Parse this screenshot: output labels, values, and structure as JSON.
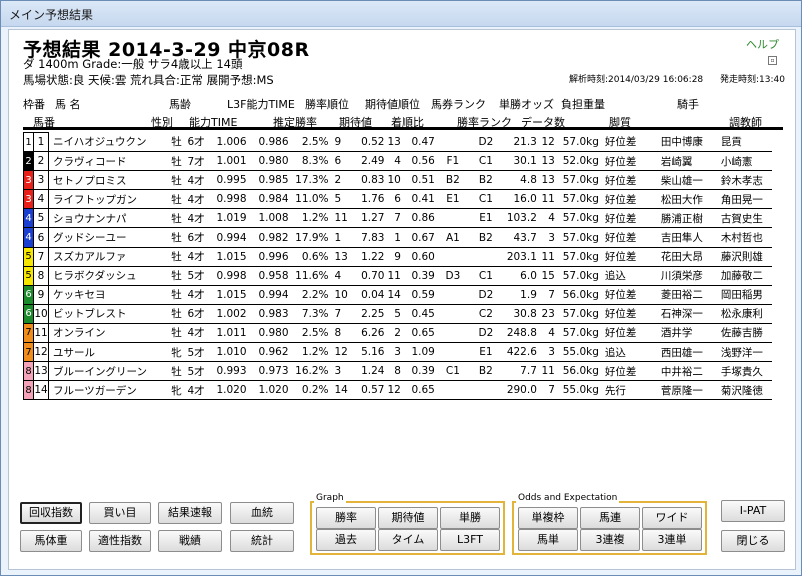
{
  "window": {
    "title": "メイン予想結果"
  },
  "race": {
    "title": "予想結果 2014-3-29 中京08R",
    "help": "ヘルプ",
    "condition1": "ダ 1400m  Grade:一般 サラ4歳以上  14頭",
    "condition2": "馬場状態:良   天候:雲   荒れ具合:正常   展開予想:MS",
    "analysis_time": "解析時刻:2014/03/29 16:06:28",
    "start_time": "発走時刻:13:40"
  },
  "header_top": {
    "waku": "枠番",
    "uma": "馬  名",
    "age": "馬齢",
    "l3f": "L3F能力TIME",
    "win_rank": "勝率順位",
    "exp_rank": "期待値順位",
    "ticket_rank": "馬券ランク",
    "odds": "単勝オッズ",
    "weight": "負担重量",
    "jockey": "騎手"
  },
  "header_bottom": {
    "umaban": "馬番",
    "sex": "性別",
    "ability": "能力TIME",
    "est_win": "推定勝率",
    "exp_val": "期待値",
    "order_ratio": "着順比",
    "win_rank": "勝率ランク",
    "data_count": "データ数",
    "style": "脚質",
    "trainer": "調教師"
  },
  "colors": {
    "frame1": "#ffffff",
    "frame2": "#000000",
    "frame3": "#e8201a",
    "frame4": "#1a3fd0",
    "frame5": "#f5e600",
    "frame6": "#1a8a2a",
    "frame7": "#f08c1a",
    "frame8": "#f5a3b8",
    "group_border": "#e2b43a",
    "help": "#2f8a2f"
  },
  "rows": [
    {
      "waku": "1",
      "num": "1",
      "name": "ニイハオジュウクン",
      "sex": "牡",
      "age": "6才",
      "ability": "1.006",
      "l3f": "0.986",
      "est": "2.5%",
      "wrank": "9",
      "exp": "0.52",
      "erank": "13",
      "order": "0.47",
      "ticket": "",
      "rank": "D2",
      "odds": "21.3",
      "data": "12",
      "weight": "57.0kg",
      "style": "好位差",
      "jockey": "田中博康",
      "trainer": "昆貢"
    },
    {
      "waku": "2",
      "num": "2",
      "name": "クラヴィコード",
      "sex": "牡",
      "age": "7才",
      "ability": "1.001",
      "l3f": "0.980",
      "est": "8.3%",
      "wrank": "6",
      "exp": "2.49",
      "erank": "4",
      "order": "0.56",
      "ticket": "F1",
      "rank": "C1",
      "odds": "30.1",
      "data": "13",
      "weight": "52.0kg",
      "style": "好位差",
      "jockey": "岩崎翼",
      "trainer": "小崎憲"
    },
    {
      "waku": "3",
      "num": "3",
      "name": "セトノプロミス",
      "sex": "牡",
      "age": "4才",
      "ability": "0.995",
      "l3f": "0.985",
      "est": "17.3%",
      "wrank": "2",
      "exp": "0.83",
      "erank": "10",
      "order": "0.51",
      "ticket": "B2",
      "rank": "B2",
      "odds": "4.8",
      "data": "13",
      "weight": "57.0kg",
      "style": "好位差",
      "jockey": "柴山雄一",
      "trainer": "鈴木孝志"
    },
    {
      "waku": "3",
      "num": "4",
      "name": "ライフトップガン",
      "sex": "牡",
      "age": "4才",
      "ability": "0.998",
      "l3f": "0.984",
      "est": "11.0%",
      "wrank": "5",
      "exp": "1.76",
      "erank": "6",
      "order": "0.41",
      "ticket": "E1",
      "rank": "C1",
      "odds": "16.0",
      "data": "11",
      "weight": "57.0kg",
      "style": "好位差",
      "jockey": "松田大作",
      "trainer": "角田晃一"
    },
    {
      "waku": "4",
      "num": "5",
      "name": "ショウナンナパ",
      "sex": "牡",
      "age": "4才",
      "ability": "1.019",
      "l3f": "1.008",
      "est": "1.2%",
      "wrank": "11",
      "exp": "1.27",
      "erank": "7",
      "order": "0.86",
      "ticket": "",
      "rank": "E1",
      "odds": "103.2",
      "data": "4",
      "weight": "57.0kg",
      "style": "好位差",
      "jockey": "勝浦正樹",
      "trainer": "古賀史生"
    },
    {
      "waku": "4",
      "num": "6",
      "name": "グッドシーユー",
      "sex": "牡",
      "age": "6才",
      "ability": "0.994",
      "l3f": "0.982",
      "est": "17.9%",
      "wrank": "1",
      "exp": "7.83",
      "erank": "1",
      "order": "0.67",
      "ticket": "A1",
      "rank": "B2",
      "odds": "43.7",
      "data": "3",
      "weight": "57.0kg",
      "style": "好位差",
      "jockey": "吉田隼人",
      "trainer": "木村哲也"
    },
    {
      "waku": "5",
      "num": "7",
      "name": "スズカアルファ",
      "sex": "牡",
      "age": "4才",
      "ability": "1.015",
      "l3f": "0.996",
      "est": "0.6%",
      "wrank": "13",
      "exp": "1.22",
      "erank": "9",
      "order": "0.60",
      "ticket": "",
      "rank": "",
      "odds": "203.1",
      "data": "11",
      "weight": "57.0kg",
      "style": "好位差",
      "jockey": "花田大昂",
      "trainer": "藤沢則雄"
    },
    {
      "waku": "5",
      "num": "8",
      "name": "ヒラボクダッシュ",
      "sex": "牡",
      "age": "5才",
      "ability": "0.998",
      "l3f": "0.958",
      "est": "11.6%",
      "wrank": "4",
      "exp": "0.70",
      "erank": "11",
      "order": "0.39",
      "ticket": "D3",
      "rank": "C1",
      "odds": "6.0",
      "data": "15",
      "weight": "57.0kg",
      "style": "追込",
      "jockey": "川須栄彦",
      "trainer": "加藤敬二"
    },
    {
      "waku": "6",
      "num": "9",
      "name": "ケッキセヨ",
      "sex": "牡",
      "age": "4才",
      "ability": "1.015",
      "l3f": "0.994",
      "est": "2.2%",
      "wrank": "10",
      "exp": "0.04",
      "erank": "14",
      "order": "0.59",
      "ticket": "",
      "rank": "D2",
      "odds": "1.9",
      "data": "7",
      "weight": "56.0kg",
      "style": "好位差",
      "jockey": "菱田裕二",
      "trainer": "岡田稲男"
    },
    {
      "waku": "6",
      "num": "10",
      "name": "ビットブレスト",
      "sex": "牡",
      "age": "6才",
      "ability": "1.002",
      "l3f": "0.983",
      "est": "7.3%",
      "wrank": "7",
      "exp": "2.25",
      "erank": "5",
      "order": "0.45",
      "ticket": "",
      "rank": "C2",
      "odds": "30.8",
      "data": "23",
      "weight": "57.0kg",
      "style": "好位差",
      "jockey": "石神深一",
      "trainer": "松永康利"
    },
    {
      "waku": "7",
      "num": "11",
      "name": "オンライン",
      "sex": "牡",
      "age": "4才",
      "ability": "1.011",
      "l3f": "0.980",
      "est": "2.5%",
      "wrank": "8",
      "exp": "6.26",
      "erank": "2",
      "order": "0.65",
      "ticket": "",
      "rank": "D2",
      "odds": "248.8",
      "data": "4",
      "weight": "57.0kg",
      "style": "好位差",
      "jockey": "酒井学",
      "trainer": "佐藤吉勝"
    },
    {
      "waku": "7",
      "num": "12",
      "name": "ユサール",
      "sex": "牝",
      "age": "5才",
      "ability": "1.010",
      "l3f": "0.962",
      "est": "1.2%",
      "wrank": "12",
      "exp": "5.16",
      "erank": "3",
      "order": "1.09",
      "ticket": "",
      "rank": "E1",
      "odds": "422.6",
      "data": "3",
      "weight": "55.0kg",
      "style": "追込",
      "jockey": "西田雄一",
      "trainer": "浅野洋一"
    },
    {
      "waku": "8",
      "num": "13",
      "name": "ブルーイングリーン",
      "sex": "牡",
      "age": "5才",
      "ability": "0.993",
      "l3f": "0.973",
      "est": "16.2%",
      "wrank": "3",
      "exp": "1.24",
      "erank": "8",
      "order": "0.39",
      "ticket": "C1",
      "rank": "B2",
      "odds": "7.7",
      "data": "11",
      "weight": "56.0kg",
      "style": "好位差",
      "jockey": "中井裕二",
      "trainer": "手塚貴久"
    },
    {
      "waku": "8",
      "num": "14",
      "name": "フルーツガーデン",
      "sex": "牝",
      "age": "4才",
      "ability": "1.020",
      "l3f": "1.020",
      "est": "0.2%",
      "wrank": "14",
      "exp": "0.57",
      "erank": "12",
      "order": "0.65",
      "ticket": "",
      "rank": "",
      "odds": "290.0",
      "data": "7",
      "weight": "55.0kg",
      "style": "先行",
      "jockey": "菅原隆一",
      "trainer": "菊沢隆徳"
    }
  ],
  "buttons": {
    "recovery": "回収指数",
    "buy": "買い目",
    "result": "結果速報",
    "blood": "血統",
    "weight": "馬体重",
    "aptitude": "適性指数",
    "record": "戦績",
    "stats": "統計",
    "graph_label": "Graph",
    "win_rate": "勝率",
    "expect": "期待値",
    "tansho": "単勝",
    "past": "過去",
    "time": "タイム",
    "l3ft": "L3FT",
    "odds_label": "Odds and Expectation",
    "wakuren": "単複枠",
    "umaren": "馬連",
    "wide": "ワイド",
    "umatan": "馬単",
    "sanrenpuku": "3連複",
    "sanrentan": "3連単",
    "ipat": "I-PAT",
    "close": "閉じる"
  }
}
